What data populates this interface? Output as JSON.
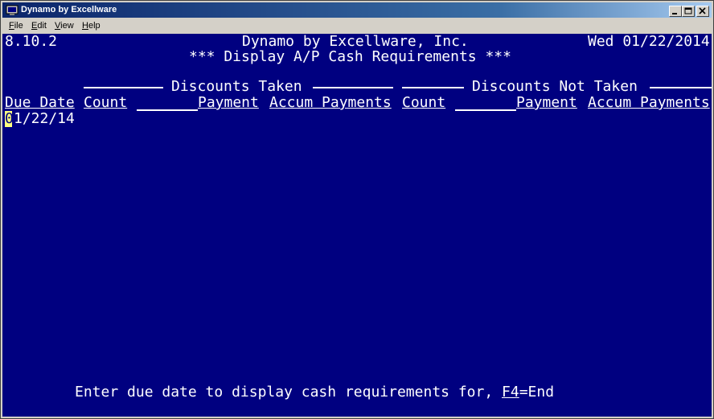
{
  "window": {
    "title": "Dynamo by Excellware",
    "icon": "terminal-app-icon",
    "controls": [
      "minimize-icon",
      "restore-icon",
      "close-icon"
    ]
  },
  "menu": {
    "items": [
      {
        "label": "File",
        "mnemonic": "F",
        "rest": "ile"
      },
      {
        "label": "Edit",
        "mnemonic": "E",
        "rest": "dit"
      },
      {
        "label": "View",
        "mnemonic": "V",
        "rest": "iew"
      },
      {
        "label": "Help",
        "mnemonic": "H",
        "rest": "elp"
      }
    ]
  },
  "screen": {
    "version": "8.10.2",
    "company": "Dynamo by Excellware, Inc.",
    "date": "Wed 01/22/2014",
    "subtitle": "*** Display A/P Cash Requirements ***",
    "group_taken": "Discounts Taken",
    "group_not_taken": "Discounts Not Taken",
    "columns": {
      "due_date": "Due Date",
      "count_taken": "Count",
      "payment_taken": "Payment",
      "accum_taken": "Accum Payments",
      "count_not_taken": "Count",
      "payment_not_taken": "Payment",
      "accum_not_taken": "Accum Payments"
    },
    "input_value_first": "0",
    "input_value_rest": "1/22/14",
    "prompt_text": "Enter due date to display cash requirements for, ",
    "prompt_key": "F4",
    "prompt_key_action": "=End"
  },
  "colors": {
    "screen_bg": "#000080",
    "text": "#ffffff",
    "cursor": "#ffff80"
  }
}
